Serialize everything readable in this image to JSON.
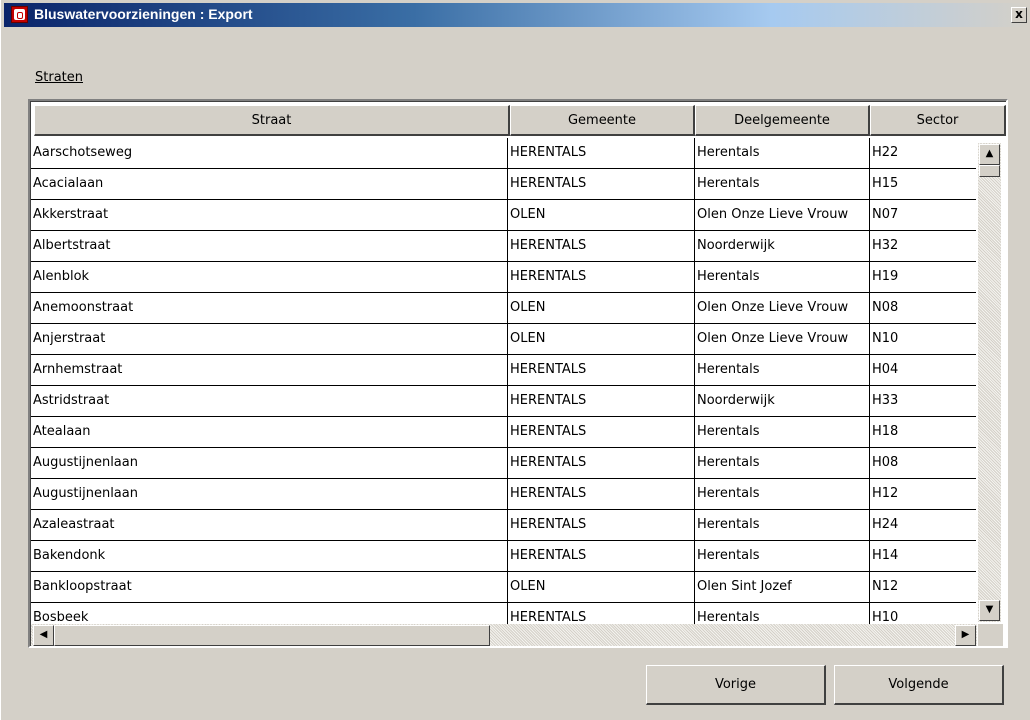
{
  "window": {
    "title": "Bluswatervoorzieningen : Export",
    "close_glyph": "x"
  },
  "section": {
    "label": "Straten"
  },
  "table": {
    "columns": [
      "Straat",
      "Gemeente",
      "Deelgemeente",
      "Sector"
    ],
    "rows": [
      [
        "Aarschotseweg",
        "HERENTALS",
        "Herentals",
        "H22"
      ],
      [
        "Acacialaan",
        "HERENTALS",
        "Herentals",
        "H15"
      ],
      [
        "Akkerstraat",
        "OLEN",
        "Olen Onze Lieve Vrouw",
        "N07"
      ],
      [
        "Albertstraat",
        "HERENTALS",
        "Noorderwijk",
        "H32"
      ],
      [
        "Alenblok",
        "HERENTALS",
        "Herentals",
        "H19"
      ],
      [
        "Anemoonstraat",
        "OLEN",
        "Olen Onze Lieve Vrouw",
        "N08"
      ],
      [
        "Anjerstraat",
        "OLEN",
        "Olen Onze Lieve Vrouw",
        "N10"
      ],
      [
        "Arnhemstraat",
        "HERENTALS",
        "Herentals",
        "H04"
      ],
      [
        "Astridstraat",
        "HERENTALS",
        "Noorderwijk",
        "H33"
      ],
      [
        "Atealaan",
        "HERENTALS",
        "Herentals",
        "H18"
      ],
      [
        "Augustijnenlaan",
        "HERENTALS",
        "Herentals",
        "H08"
      ],
      [
        "Augustijnenlaan",
        "HERENTALS",
        "Herentals",
        "H12"
      ],
      [
        "Azaleastraat",
        "HERENTALS",
        "Herentals",
        "H24"
      ],
      [
        "Bakendonk",
        "HERENTALS",
        "Herentals",
        "H14"
      ],
      [
        "Bankloopstraat",
        "OLEN",
        "Olen Sint Jozef",
        "N12"
      ],
      [
        "Bosbeek",
        "HERENTALS",
        "Herentals",
        "H10"
      ]
    ]
  },
  "scroll": {
    "up_glyph": "▲",
    "down_glyph": "▼",
    "left_glyph": "◀",
    "right_glyph": "▶"
  },
  "buttons": {
    "previous": "Vorige",
    "next": "Volgende"
  },
  "icons": {
    "app": "app-logo-icon",
    "close": "close-icon"
  }
}
